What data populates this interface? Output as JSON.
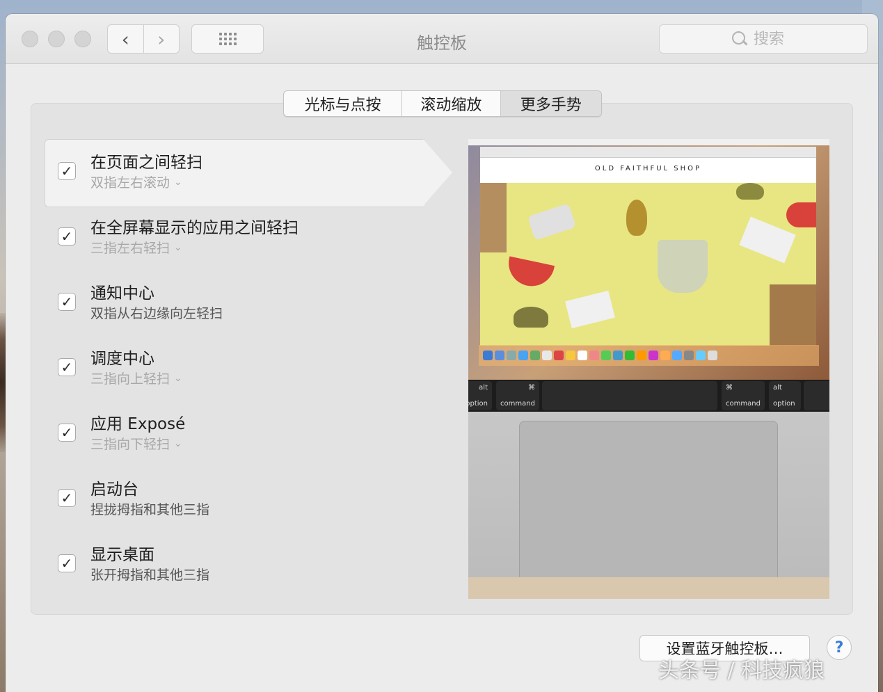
{
  "window": {
    "title": "触控板"
  },
  "search": {
    "placeholder": "搜索"
  },
  "tabs": [
    {
      "label": "光标与点按"
    },
    {
      "label": "滚动缩放"
    },
    {
      "label": "更多手势"
    }
  ],
  "gestures": [
    {
      "title": "在页面之间轻扫",
      "subtitle": "双指左右滚动",
      "checked": true,
      "has_menu": true
    },
    {
      "title": "在全屏幕显示的应用之间轻扫",
      "subtitle": "三指左右轻扫",
      "checked": true,
      "has_menu": true
    },
    {
      "title": "通知中心",
      "subtitle": "双指从右边缘向左轻扫",
      "checked": true,
      "has_menu": false
    },
    {
      "title": "调度中心",
      "subtitle": "三指向上轻扫",
      "checked": true,
      "has_menu": true
    },
    {
      "title": "应用 Exposé",
      "subtitle": "三指向下轻扫",
      "checked": true,
      "has_menu": true
    },
    {
      "title": "启动台",
      "subtitle": "捏拢拇指和其他三指",
      "checked": true,
      "has_menu": false
    },
    {
      "title": "显示桌面",
      "subtitle": "张开拇指和其他三指",
      "checked": true,
      "has_menu": false
    }
  ],
  "preview": {
    "shop_title": "OLD FAITHFUL SHOP",
    "keys": {
      "alt_left": "alt",
      "option_left": "option",
      "cmd_symbol": "⌘",
      "command_left": "command",
      "command_right": "command",
      "alt_right": "alt",
      "option_right": "option"
    }
  },
  "footer": {
    "bluetooth_button": "设置蓝牙触控板…",
    "help_label": "?"
  },
  "watermark": "头条号 / 科技疯狼",
  "icons": {
    "check": "✓",
    "chevron": "⌄",
    "back": "‹",
    "forward": "›"
  },
  "colors": {
    "accent": "#3b7fd9",
    "panel": "#e3e3e3",
    "selected_row": "#f2f2f2"
  }
}
